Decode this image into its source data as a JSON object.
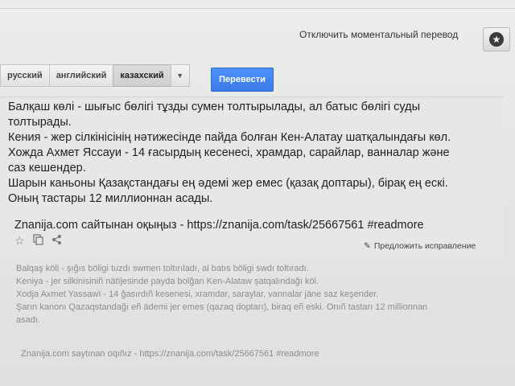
{
  "header": {
    "instant_toggle": "Отключить моментальный перевод",
    "star_icon": "star-icon"
  },
  "languages": {
    "tabs": [
      {
        "label": "русский",
        "active": false
      },
      {
        "label": "английский",
        "active": false
      },
      {
        "label": "казахский",
        "active": true
      }
    ],
    "dropdown_icon": "chevron-down-icon"
  },
  "translate_button": "Перевести",
  "source": {
    "lines": [
      "Балқаш көлі - шығыс бөлігі тұзды сумен толтырылады, ал батыс бөлігі суды",
      "толтырады.",
      "Кения - жер сілкінісінің нәтижесінде пайда болған Кен-Алатау шатқалындағы көл.",
      "Хожда Ахмет Яссауи - 14 ғасырдың кесенесі, храмдар, сарайлар, ванналар және",
      "саз кешендер.",
      "Шарын каньоны Қазақстандағы ең әдемі жер емес (қазақ доптары), бірақ ең ескі.",
      "Оның тастары 12 миллионнан асады."
    ],
    "citation": "Znanija.com сайтынан оқыңыз - https://znanija.com/task/25667561 #readmore"
  },
  "actions": {
    "suggest": "Предложить исправление",
    "icons": [
      "star-outline-icon",
      "copy-icon",
      "share-icon",
      "pencil-icon"
    ]
  },
  "transliteration": {
    "lines": [
      "Balqaş köli - şığıs böligi tuzdı swmen toltırıladı, al batıs böligi swdı toltıradı.",
      "Keniya - jer silkinisiniñ nätïjesinde payda bolğan Ken-Alataw şatqalındağı köl.",
      "Xodja Axmet Yassawï - 14 ğasırdıñ kesenesi, xramdar, saraylar, vannalar jäne saz keşender.",
      "Şarın kanonı Qazaqstandağı eñ ädemi jer emes (qazaq doptarı), biraq eñ eski. Onıñ tastarı 12 millionnan",
      "asadı."
    ],
    "citation": "Znanija.com saytınan oqıñız - https://znanija.com/task/25667561 #readmore"
  }
}
